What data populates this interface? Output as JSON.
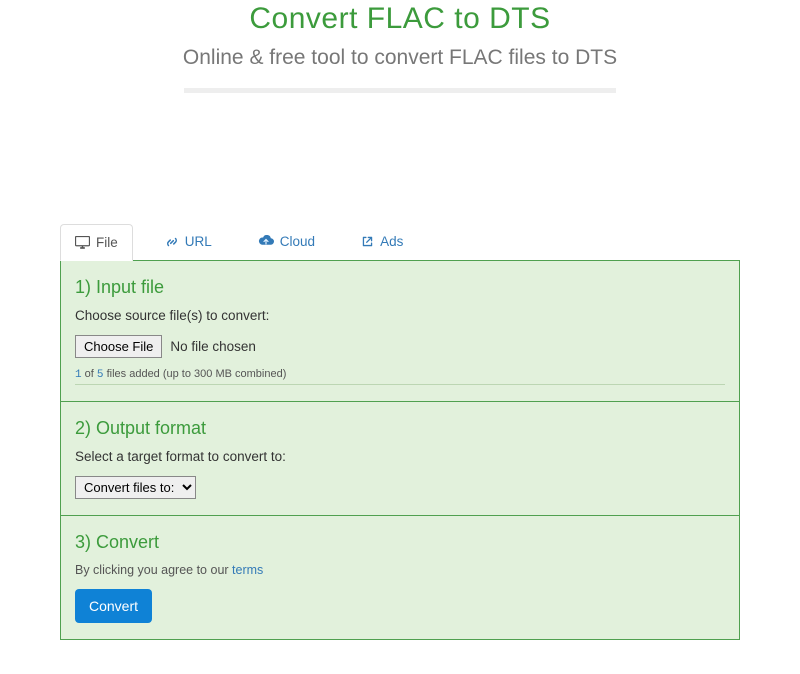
{
  "header": {
    "title": "Convert FLAC to DTS",
    "subtitle": "Online & free tool to convert FLAC files to DTS"
  },
  "tabs": {
    "file": "File",
    "url": "URL",
    "cloud": "Cloud",
    "ads": "Ads"
  },
  "step1": {
    "title": "1) Input file",
    "prompt": "Choose source file(s) to convert:",
    "choose_label": "Choose File",
    "file_status": "No file chosen",
    "limit_num": "1",
    "limit_of": "of",
    "limit_max": "5",
    "limit_rest": "files added (up to 300 MB combined)"
  },
  "step2": {
    "title": "2) Output format",
    "prompt": "Select a target format to convert to:",
    "select_label": "Convert files to:"
  },
  "step3": {
    "title": "3) Convert",
    "agree_pre": "By clicking you agree to our ",
    "agree_link": "terms",
    "button": "Convert"
  }
}
